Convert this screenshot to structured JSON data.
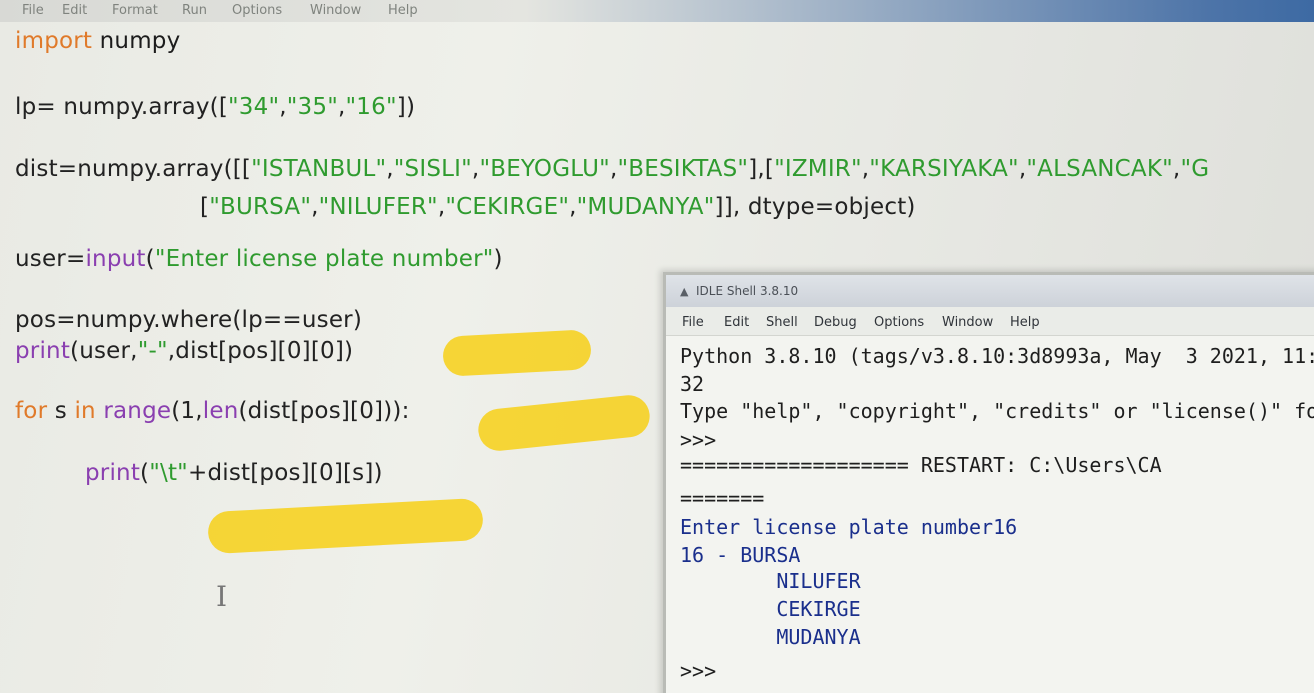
{
  "editor": {
    "menu": [
      "File",
      "Edit",
      "Format",
      "Run",
      "Options",
      "Window",
      "Help"
    ],
    "code": {
      "line1": {
        "kw": "import",
        "rest": " numpy"
      },
      "line2": {
        "a": "lp= numpy.array([",
        "s1": "\"34\"",
        "c1": ",",
        "s2": "\"35\"",
        "c2": ",",
        "s3": "\"16\"",
        "end": "])"
      },
      "line3": {
        "a": "dist=numpy.array([[",
        "s1": "\"ISTANBUL\"",
        "c1": ",",
        "s2": "\"SISLI\"",
        "c2": ",",
        "s3": "\"BEYOGLU\"",
        "c3": ",",
        "s4": "\"BESIKTAS\"",
        "m1": "],[",
        "s5": "\"IZMIR\"",
        "c4": ",",
        "s6": "\"KARSIYAKA\"",
        "c5": ",",
        "s7": "\"ALSANCAK\"",
        "c6": ",",
        "s8": "\"G"
      },
      "line4": {
        "a": "[",
        "s1": "\"BURSA\"",
        "c1": ",",
        "s2": "\"NILUFER\"",
        "c2": ",",
        "s3": "\"CEKIRGE\"",
        "c3": ",",
        "s4": "\"MUDANYA\"",
        "end": "]], dtype=object)"
      },
      "line5": {
        "a": "user=",
        "bi": "input",
        "b": "(",
        "s": "\"Enter license plate number\"",
        "c": ")"
      },
      "line6": "pos=numpy.where(lp==user)",
      "line7": {
        "bi": "print",
        "a": "(user,",
        "s": "\"-\"",
        "b": ",dist[pos][0][0])"
      },
      "line8": {
        "kw1": "for",
        "a": " s ",
        "kw2": "in",
        "b": " ",
        "bi1": "range",
        "c": "(1,",
        "bi2": "len",
        "d": "(dist[pos][0])):"
      },
      "line9": {
        "bi": "print",
        "a": "(",
        "s": "\"\\t\"",
        "b": "+dist[pos][0][s])"
      }
    }
  },
  "shell": {
    "title": "IDLE Shell 3.8.10",
    "menu": [
      "File",
      "Edit",
      "Shell",
      "Debug",
      "Options",
      "Window",
      "Help"
    ],
    "lines": [
      "Python 3.8.10 (tags/v3.8.10:3d8993a, May  3 2021, 11:",
      "32",
      "Type \"help\", \"copyright\", \"credits\" or \"license()\" for mor",
      ">>>",
      "=================== RESTART: C:\\Users\\CA",
      "=======",
      "Enter license plate number16",
      "16 - BURSA",
      "        NILUFER",
      "        CEKIRGE",
      "        MUDANYA",
      "",
      ">>>"
    ]
  },
  "colors": {
    "keyword": "#e07a2a",
    "builtin": "#8a3fb0",
    "string": "#2f9b2f",
    "marker": "#f6d32c",
    "output": "#1a2f8c"
  }
}
